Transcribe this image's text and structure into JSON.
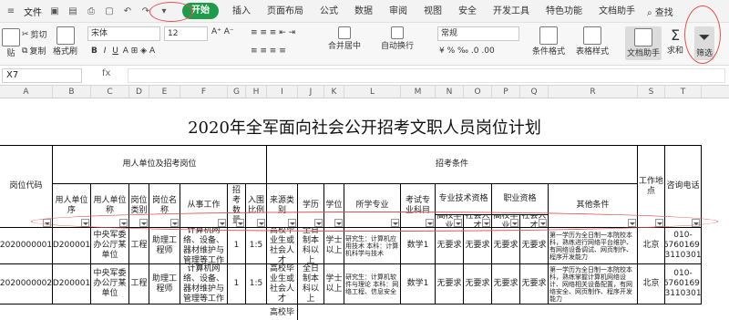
{
  "menubar": {
    "file": "文件",
    "tabs": [
      "开始",
      "插入",
      "页面布局",
      "公式",
      "数据",
      "审阅",
      "视图",
      "安全",
      "开发工具",
      "特色功能",
      "文档助手"
    ],
    "active_tab": "开始",
    "search": "查找"
  },
  "toolbar": {
    "paste": "贴",
    "cut": "剪切",
    "copy": "复制",
    "format_painter": "格式刷",
    "font": "宋体",
    "font_size": "12",
    "merge": "合并居中",
    "wrap": "自动换行",
    "number_format": "常规",
    "cond_format": "条件格式",
    "table_style": "表格样式",
    "doc_helper": "文档助手",
    "sum": "求和",
    "filter": "筛选"
  },
  "formula": {
    "cell_ref": "X7",
    "fx": "fx"
  },
  "columns": [
    "A",
    "B",
    "C",
    "D",
    "E",
    "F",
    "G",
    "H",
    "I",
    "J",
    "K",
    "L",
    "M",
    "N",
    "O",
    "P",
    "Q",
    "R",
    "S",
    "T"
  ],
  "sheet": {
    "title": "2020年全军面向社会公开招考文职人员岗位计划",
    "headers": {
      "post_code": "岗位代码",
      "group1": "用人单位及招考岗位",
      "unit_seq": "用人单位序",
      "unit_name": "用人单位称",
      "post_type": "岗位类别",
      "post_name": "岗位名称",
      "work": "从事工作",
      "quota": "招考数量",
      "ratio": "入围比例",
      "group2": "招考条件",
      "source": "来源类别",
      "edu": "学历",
      "degree": "学位",
      "major": "所学专业",
      "exam": "考试专业科目",
      "skill": "专业技术资格",
      "skill_hi": "高校毕业",
      "skill_soc": "社会人才",
      "job": "职业资格",
      "job_hi": "高校毕业",
      "job_soc": "社会人才",
      "other": "其他条件",
      "place": "工作地点",
      "phone": "咨询电话"
    },
    "rows": [
      {
        "code": "2020000001",
        "unit_seq": "D200001",
        "unit_name": "中央军委办公厅某单位",
        "post_type": "工程",
        "post_name": "助理工程师",
        "work": "计算机网络、设备、器材维护与管理等工作",
        "quota": "1",
        "ratio": "1:5",
        "source": "高校毕业生或社会人才",
        "edu": "全日制本科以上",
        "degree": "学士以上",
        "major": "研究生：计算机应用技术 本科：计算机科学与技术",
        "exam": "数学1",
        "skill_hi": "无要求",
        "skill_soc": "无要求",
        "job_hi": "无要求",
        "job_soc": "无要求",
        "other": "第一学历为全日制一本院校本科，熟练进行网络平台维护、有网络设备调试、网页制作、程序开发能力",
        "place": "北京",
        "phone": "010-66760169，15311030178"
      },
      {
        "code": "2020000002",
        "unit_seq": "D200001",
        "unit_name": "中央军委办公厅某单位",
        "post_type": "工程",
        "post_name": "助理工程师",
        "work": "计算机网络、设备、器材维护与管理等工作",
        "quota": "1",
        "ratio": "1:5",
        "source": "高校毕业生或社会人才",
        "edu": "全日制本科以上",
        "degree": "学士以上",
        "major": "研究生：计算机软件与理论 本科：网络工程、信息安全",
        "exam": "数学1",
        "skill_hi": "无要求",
        "skill_soc": "无要求",
        "job_hi": "无要求",
        "job_soc": "无要求",
        "other": "第一学历为全日制一本院校本科，熟练掌握计算机网络设计、网络相关设备配置，有网络安全、网页制作、程序开发能力",
        "place": "北京",
        "phone": "010-66760169，15311030178"
      }
    ],
    "row3_source": "高校毕"
  },
  "row_numbers": [
    "1",
    "2",
    "3",
    "4",
    "5",
    "6",
    "7"
  ]
}
